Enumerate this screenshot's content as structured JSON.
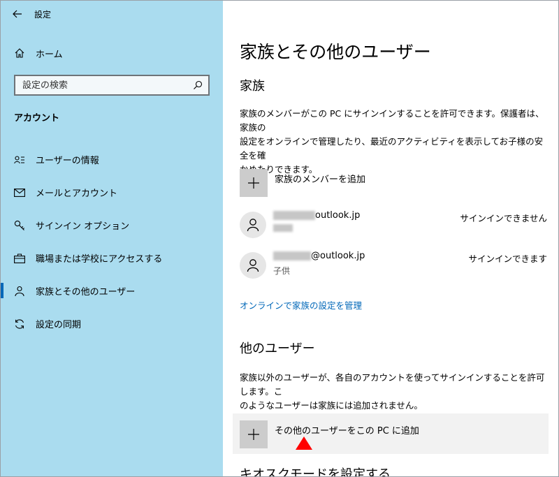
{
  "window": {
    "title": "設定"
  },
  "sidebar": {
    "home_label": "ホーム",
    "search": {
      "placeholder": "設定の検索"
    },
    "section_title": "アカウント",
    "items": [
      {
        "label": "ユーザーの情報",
        "icon": "person-card-icon"
      },
      {
        "label": "メールとアカウント",
        "icon": "mail-icon"
      },
      {
        "label": "サインイン オプション",
        "icon": "key-icon"
      },
      {
        "label": "職場または学校にアクセスする",
        "icon": "briefcase-icon"
      },
      {
        "label": "家族とその他のユーザー",
        "icon": "family-icon",
        "active": true
      },
      {
        "label": "設定の同期",
        "icon": "sync-icon"
      }
    ]
  },
  "main": {
    "title": "家族とその他のユーザー",
    "family": {
      "heading": "家族",
      "description_lines": [
        "家族のメンバーがこの PC にサインインすることを許可できます。保護者は、家族の",
        "設定をオンラインで管理したり、最近のアクティビティを表示してお子様の安全を確",
        "かめたりできます。"
      ],
      "add_label": "家族のメンバーを追加",
      "members": [
        {
          "email_suffix": "outlook.jp",
          "role": "",
          "status": "サインインできません"
        },
        {
          "email_suffix": "@outlook.jp",
          "role": "子供",
          "status": "サインインできます"
        }
      ],
      "manage_link": "オンラインで家族の設定を管理"
    },
    "other_users": {
      "heading": "他のユーザー",
      "description_lines": [
        "家族以外のユーザーが、各自のアカウントを使ってサインインすることを許可します。こ",
        "のようなユーザーは家族には追加されません。"
      ],
      "add_label": "その他のユーザーをこの PC に追加"
    },
    "next_heading": "キオスクモードを設定する"
  },
  "colors": {
    "sidebar_bg": "#aadcef",
    "accent": "#0067b8",
    "marker": "#ff0000"
  }
}
